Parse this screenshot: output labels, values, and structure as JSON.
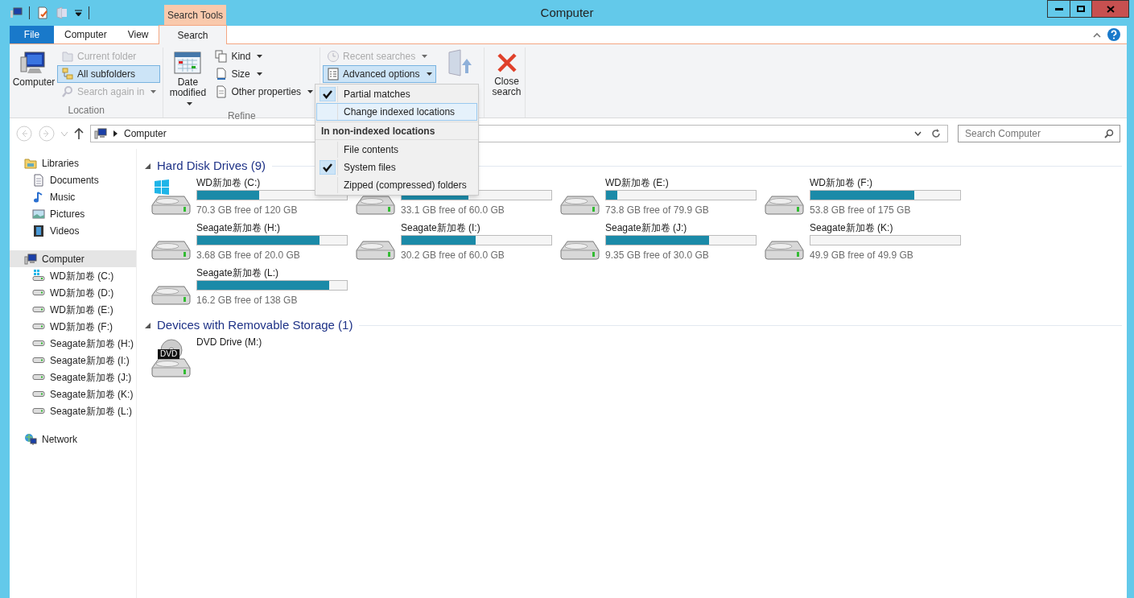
{
  "window": {
    "title": "Computer",
    "context_tab": "Search Tools"
  },
  "tabs": [
    {
      "label": "File",
      "kind": "file",
      "selected": false
    },
    {
      "label": "Computer",
      "kind": "tab",
      "selected": false
    },
    {
      "label": "View",
      "kind": "tab",
      "selected": false
    },
    {
      "label": "Search",
      "kind": "tab",
      "selected": true
    }
  ],
  "ribbon": {
    "groups": [
      {
        "label": "Location",
        "large": {
          "label": "Computer",
          "dropdown": false
        },
        "small": [
          {
            "label": "Current folder",
            "disabled": true,
            "selected": false,
            "dropdown": false
          },
          {
            "label": "All subfolders",
            "disabled": false,
            "selected": true,
            "dropdown": false
          },
          {
            "label": "Search again in",
            "disabled": true,
            "selected": false,
            "dropdown": true
          }
        ]
      },
      {
        "label": "Refine",
        "large": {
          "label": "Date modified",
          "dropdown": true
        },
        "small": [
          {
            "label": "Kind",
            "disabled": false,
            "selected": false,
            "dropdown": true
          },
          {
            "label": "Size",
            "disabled": false,
            "selected": false,
            "dropdown": true
          },
          {
            "label": "Other properties",
            "disabled": false,
            "selected": false,
            "dropdown": true
          }
        ]
      },
      {
        "small": [
          {
            "label": "Recent searches",
            "disabled": true,
            "selected": false,
            "dropdown": true
          },
          {
            "label": "Advanced options",
            "disabled": false,
            "selected": true,
            "dropdown": true
          }
        ]
      }
    ],
    "close": {
      "label": "Close search"
    }
  },
  "menu": {
    "items": [
      {
        "kind": "check",
        "label": "Partial matches",
        "checked": true,
        "selected": false
      },
      {
        "kind": "action",
        "label": "Change indexed locations",
        "checked": false,
        "selected": true
      },
      {
        "kind": "header",
        "label": "In non-indexed locations"
      },
      {
        "kind": "check",
        "label": "File contents",
        "checked": false,
        "selected": false
      },
      {
        "kind": "check",
        "label": "System files",
        "checked": true,
        "selected": false
      },
      {
        "kind": "check",
        "label": "Zipped (compressed) folders",
        "checked": false,
        "selected": false
      }
    ]
  },
  "address": {
    "path": "Computer",
    "search_placeholder": "Search Computer"
  },
  "nav": [
    {
      "label": "Libraries",
      "kind": "library",
      "selected": false,
      "children": [
        {
          "label": "Documents",
          "kind": "document",
          "selected": false
        },
        {
          "label": "Music",
          "kind": "music",
          "selected": false
        },
        {
          "label": "Pictures",
          "kind": "pictures",
          "selected": false
        },
        {
          "label": "Videos",
          "kind": "videos",
          "selected": false
        }
      ]
    },
    {
      "label": "Computer",
      "kind": "computer",
      "selected": true,
      "children": [
        {
          "label": "WD新加卷 (C:)",
          "kind": "system",
          "selected": false
        },
        {
          "label": "WD新加卷 (D:)",
          "kind": "disk",
          "selected": false
        },
        {
          "label": "WD新加卷 (E:)",
          "kind": "disk",
          "selected": false
        },
        {
          "label": "WD新加卷 (F:)",
          "kind": "disk",
          "selected": false
        },
        {
          "label": "Seagate新加卷 (H:)",
          "kind": "disk",
          "selected": false
        },
        {
          "label": "Seagate新加卷 (I:)",
          "kind": "disk",
          "selected": false
        },
        {
          "label": "Seagate新加卷 (J:)",
          "kind": "disk",
          "selected": false
        },
        {
          "label": "Seagate新加卷 (K:)",
          "kind": "disk",
          "selected": false
        },
        {
          "label": "Seagate新加卷 (L:)",
          "kind": "disk",
          "selected": false
        }
      ]
    },
    {
      "label": "Network",
      "kind": "network",
      "selected": false
    }
  ],
  "sections": [
    {
      "title": "Hard Disk Drives (9)",
      "drives": [
        {
          "kind": "system",
          "name": "WD新加卷 (C:)",
          "level": 0.414,
          "free": "70.3 GB free of 120 GB"
        },
        {
          "kind": "disk",
          "level": 0.448,
          "free": "33.1 GB free of 60.0 GB"
        },
        {
          "kind": "disk",
          "name": "WD新加卷 (E:)",
          "level": 0.076,
          "free": "73.8 GB free of 79.9 GB"
        },
        {
          "kind": "disk",
          "name": "WD新加卷 (F:)",
          "level": 0.693,
          "free": "53.8 GB free of 175 GB"
        },
        {
          "kind": "disk",
          "name": "Seagate新加卷 (H:)",
          "level": 0.816,
          "free": "3.68 GB free of 20.0 GB"
        },
        {
          "kind": "disk",
          "name": "Seagate新加卷 (I:)",
          "level": 0.497,
          "free": "30.2 GB free of 60.0 GB"
        },
        {
          "kind": "disk",
          "name": "Seagate新加卷 (J:)",
          "level": 0.688,
          "free": "9.35 GB free of 30.0 GB"
        },
        {
          "kind": "disk",
          "name": "Seagate新加卷 (K:)",
          "level": 0,
          "free": "49.9 GB free of 49.9 GB"
        },
        {
          "kind": "disk",
          "name": "Seagate新加卷 (L:)",
          "level": 0.883,
          "free": "16.2 GB free of 138 GB"
        }
      ]
    },
    {
      "title": "Devices with Removable Storage (1)",
      "drives": [
        {
          "kind": "dvd",
          "badge": "DVD",
          "name": "DVD Drive (M:)"
        }
      ]
    }
  ]
}
